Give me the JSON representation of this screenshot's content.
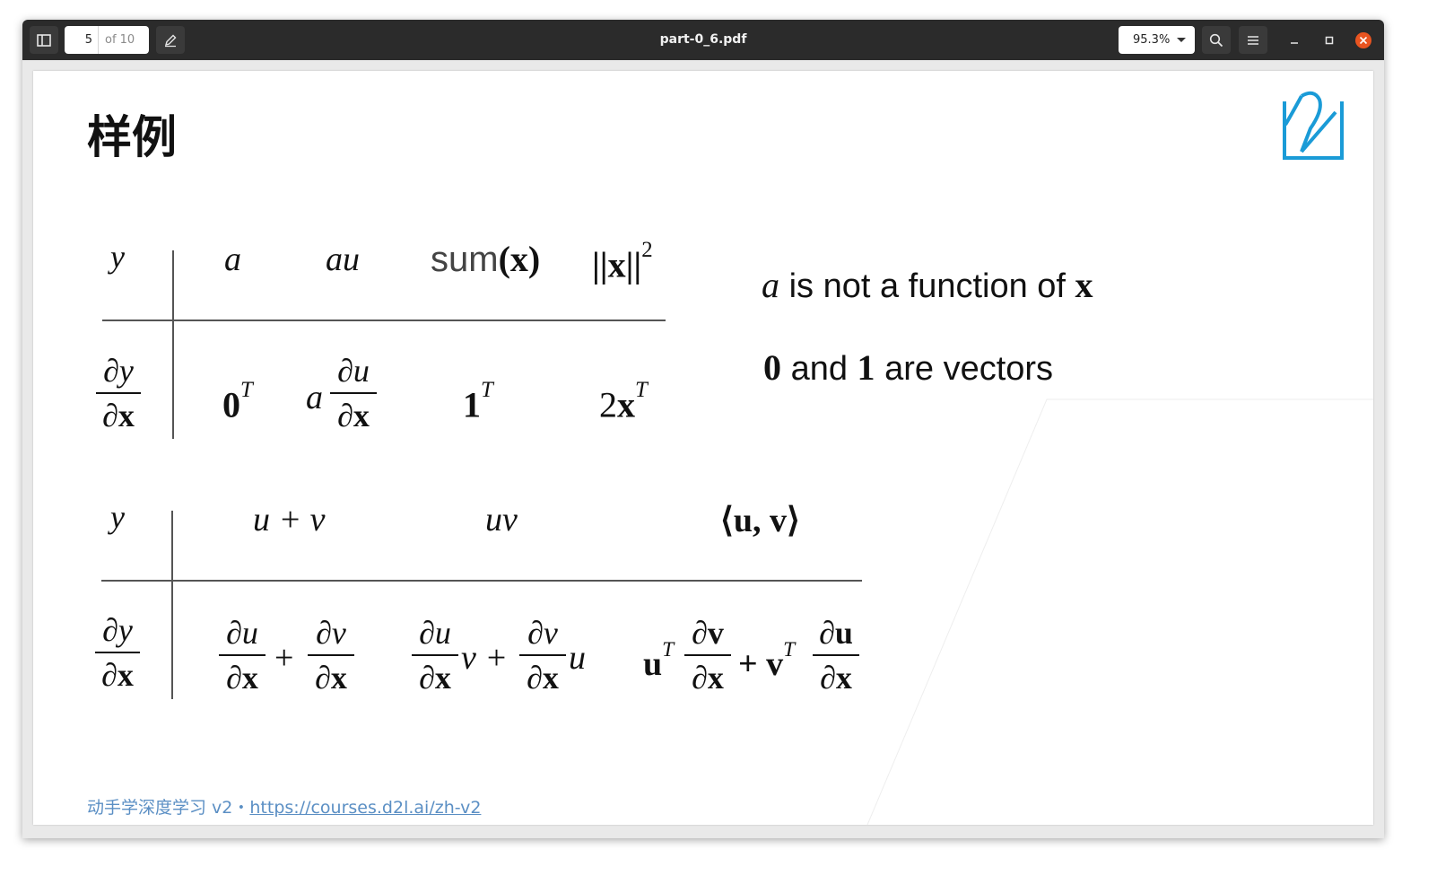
{
  "toolbar": {
    "page_current": "5",
    "page_total": "of 10",
    "file_title": "part-0_6.pdf",
    "zoom": "95.3%"
  },
  "slide": {
    "heading": "样例",
    "table1": {
      "row_y": "y",
      "col1_top": "a",
      "col2_top": "au",
      "col3_top_text": "sum",
      "col3_top_arg": "(x)",
      "col4_top_norm": "||x||",
      "col4_top_exp": "2",
      "deriv_num": "∂y",
      "deriv_den": "∂x",
      "col1_bottom_base": "0",
      "col1_bottom_exp": "T",
      "col2_bottom_prefix": "a",
      "col2_bottom_num": "∂u",
      "col2_bottom_den": "∂x",
      "col3_bottom_base": "1",
      "col3_bottom_exp": "T",
      "col4_bottom_coef": "2",
      "col4_bottom_base": "x",
      "col4_bottom_exp": "T"
    },
    "notes": {
      "line1_var": "a",
      "line1_text": "is not a function of",
      "line1_vec": "x",
      "line2_zero": "0",
      "line2_and": "and",
      "line2_one": "1",
      "line2_text": "are vectors"
    },
    "table2": {
      "row_y": "y",
      "col1_top": "u + v",
      "col2_top": "uv",
      "col3_top": "⟨u, v⟩",
      "deriv_num": "∂y",
      "deriv_den": "∂x",
      "c1_num1": "∂u",
      "c1_den1": "∂x",
      "c1_plus": "+",
      "c1_num2": "∂v",
      "c1_den2": "∂x",
      "c2_num1": "∂u",
      "c2_den1": "∂x",
      "c2_mid": "v +",
      "c2_num2": "∂v",
      "c2_den2": "∂x",
      "c2_end": "u",
      "c3_u": "u",
      "c3_exp1": "T",
      "c3_num1": "∂v",
      "c3_den1": "∂x",
      "c3_plus": "+ v",
      "c3_exp2": "T",
      "c3_num2": "∂u",
      "c3_den2": "∂x"
    },
    "footer_text": "动手学深度学习 v2・",
    "footer_link": "https://courses.d2l.ai/zh-v2"
  },
  "colors": {
    "logo": "#1a9bd7",
    "close_button": "#e95420",
    "footer": "#5b8fc4"
  },
  "icons": [
    "sidebar-toggle-icon",
    "annotate-pen-icon",
    "search-icon",
    "hamburger-menu-icon",
    "minimize-icon",
    "maximize-icon",
    "close-icon",
    "d2l-logo"
  ]
}
